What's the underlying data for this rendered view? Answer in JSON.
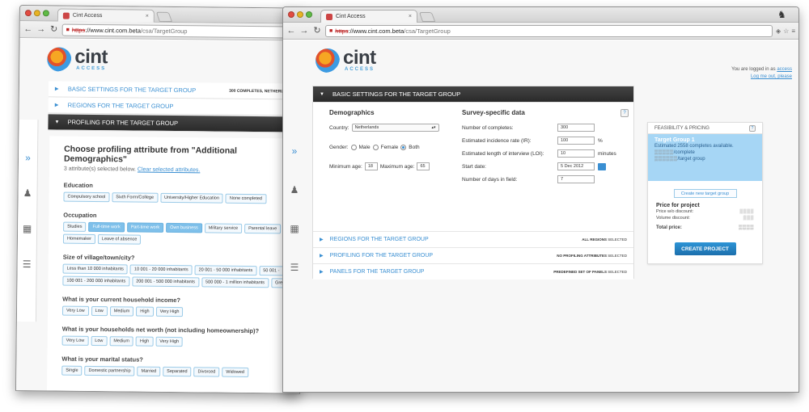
{
  "browser": {
    "tab_title": "Cint Access",
    "url_scheme": "https",
    "url_host": "://www.cint.com.beta",
    "url_path": "/csa/TargetGroup"
  },
  "logo": {
    "name": "cint",
    "sub": "ACCESS"
  },
  "session": {
    "logged_in_as": "You are logged in as",
    "user": "access",
    "logout": "Log me out, please"
  },
  "back_window": {
    "sections": {
      "basic": "BASIC SETTINGS FOR THE TARGET GROUP",
      "basic_meta_count": "300 COMPLETES,",
      "basic_meta_country": "NETHERLANDS,",
      "regions": "REGIONS FOR THE TARGET GROUP",
      "profiling": "PROFILING FOR THE TARGET GROUP"
    },
    "profiling_title": "Choose profiling attribute from \"Additional Demographics\"",
    "profiling_sub": "3 attribute(s) selected below.",
    "profiling_link": "Clear selected attributes.",
    "categories": [
      {
        "label": "Education",
        "options": [
          {
            "t": "Compulsory school",
            "s": false
          },
          {
            "t": "Sixth Form/College",
            "s": false
          },
          {
            "t": "University/Higher Education",
            "s": false
          },
          {
            "t": "None completed",
            "s": false
          }
        ]
      },
      {
        "label": "Occupation",
        "options": [
          {
            "t": "Studies",
            "s": false
          },
          {
            "t": "Full-time work",
            "s": true
          },
          {
            "t": "Part-time work",
            "s": true
          },
          {
            "t": "Own business",
            "s": true
          },
          {
            "t": "Military service",
            "s": false
          },
          {
            "t": "Parental leave",
            "s": false
          },
          {
            "t": "Homemaker",
            "s": false
          },
          {
            "t": "Leave of absence",
            "s": false
          }
        ]
      },
      {
        "label": "Size of village/town/city?",
        "options": [
          {
            "t": "Less than 10 000 inhabitants",
            "s": false
          },
          {
            "t": "10 001 - 20 000 inhabitants",
            "s": false
          },
          {
            "t": "20 001 - 50 000 inhabitants",
            "s": false
          },
          {
            "t": "50 001 -",
            "s": false
          },
          {
            "t": "100 001 - 200 000 inhabitants",
            "s": false
          },
          {
            "t": "200 001 - 500 000 inhabitants",
            "s": false
          },
          {
            "t": "500 000 - 1 million inhabitants",
            "s": false
          },
          {
            "t": "Gre",
            "s": false
          }
        ]
      },
      {
        "label": "What is your current household income?",
        "options": [
          {
            "t": "Very Low",
            "s": false
          },
          {
            "t": "Low",
            "s": false
          },
          {
            "t": "Medium",
            "s": false
          },
          {
            "t": "High",
            "s": false
          },
          {
            "t": "Very High",
            "s": false
          }
        ]
      },
      {
        "label": "What is your households net worth (not including homeownership)?",
        "options": [
          {
            "t": "Very Low",
            "s": false
          },
          {
            "t": "Low",
            "s": false
          },
          {
            "t": "Medium",
            "s": false
          },
          {
            "t": "High",
            "s": false
          },
          {
            "t": "Very High",
            "s": false
          }
        ]
      },
      {
        "label": "What is your marital status?",
        "options": [
          {
            "t": "Single",
            "s": false
          },
          {
            "t": "Domestic partnership",
            "s": false
          },
          {
            "t": "Married",
            "s": false
          },
          {
            "t": "Separated",
            "s": false
          },
          {
            "t": "Divorced",
            "s": false
          },
          {
            "t": "Widowed",
            "s": false
          }
        ]
      }
    ]
  },
  "front_window": {
    "basic_header": "BASIC SETTINGS FOR THE TARGET GROUP",
    "demographics": {
      "title": "Demographics",
      "country_label": "Country:",
      "country_value": "Netherlands",
      "gender_label": "Gender:",
      "gender_options": [
        "Male",
        "Female",
        "Both"
      ],
      "min_age_label": "Minimum age:",
      "min_age": "18",
      "max_age_label": "Maximum age:",
      "max_age": "65"
    },
    "survey": {
      "title": "Survey-specific data",
      "rows": [
        {
          "label": "Number of completes:",
          "value": "300",
          "unit": ""
        },
        {
          "label": "Estimated incidence rate (IR):",
          "value": "100",
          "unit": "%"
        },
        {
          "label": "Estimated length of interview (LOI):",
          "value": "10",
          "unit": "minutes"
        },
        {
          "label": "Start date:",
          "value": "5 Dec 2012",
          "unit": ""
        },
        {
          "label": "Number of days in field:",
          "value": "7",
          "unit": ""
        }
      ]
    },
    "collapsed": [
      {
        "title": "REGIONS FOR THE TARGET GROUP",
        "meta_b": "ALL REGIONS",
        "meta": "SELECTED"
      },
      {
        "title": "PROFILING FOR THE TARGET GROUP",
        "meta_b": "NO PROFILING ATTRIBUTES",
        "meta": "SELECTED"
      },
      {
        "title": "PANELS FOR THE TARGET GROUP",
        "meta_b": "PREDEFINED SET OF PANELS",
        "meta": "SELECTED"
      }
    ],
    "feasibility": {
      "title": "FEASIBILITY & PRICING",
      "tg_title": "Target Group 1",
      "tg_line1": "Estimated 2558 completes available.",
      "tg_line2": "/complete",
      "tg_line3": "/target group",
      "new_tg": "Create new target group",
      "price_title": "Price for project",
      "price_wo": "Price w/o discount:",
      "volume": "Volume discount:",
      "total": "Total price:",
      "create": "CREATE PROJECT"
    }
  }
}
